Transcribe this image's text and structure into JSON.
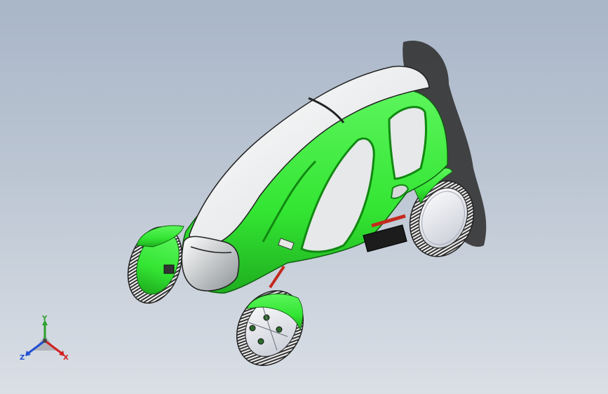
{
  "viewport": {
    "background_top": "#a9b6c8",
    "background_bottom": "#dadfe6"
  },
  "model": {
    "body_color": "#33e533",
    "body_dark": "#1fb81f",
    "canopy_color": "#eef0f0",
    "window_color": "#e6e8ea",
    "tire_color": "#2b2b2b",
    "hub_color": "#e4e6ec",
    "arm_color": "#c42a1e",
    "motor_color": "#1c1c1c"
  },
  "triad": {
    "y_label": "Y",
    "z_label": "Z",
    "x_label": "X",
    "y_color": "#2ba02b",
    "z_color": "#1f4fd1",
    "x_color": "#d12020"
  }
}
